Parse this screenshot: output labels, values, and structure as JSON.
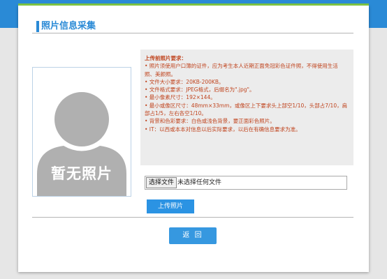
{
  "section": {
    "title": "照片信息采集"
  },
  "photo": {
    "placeholder_text": "暂无照片",
    "icon": "user-silhouette-icon"
  },
  "notes": {
    "title": "上传前照片要求：",
    "lines": [
      "• 照片须使用户口簿的证件，应为考生本人近期正面免冠彩色证件照，不得使用生活照、美颜照。",
      "• 文件大小要求：20KB-200KB。",
      "• 文件格式要求：JPEG格式，后缀名为\".jpg\"。",
      "• 最小像素尺寸：192×144。",
      "• 最小或像区尺寸：48mm×33mm，或像区上下要求头上部空1/10，头部占7/10，肩部占1/5，左右各空1/10。",
      "• 背景和色彩要求：白色或浅色背景，要正面彩色照片。",
      "• IT：以西或本本对信息以后实际要求，以后在有确信息要求为准。"
    ],
    "color": "#c0441e"
  },
  "file_input": {
    "button_label": "选择文件",
    "status": "未选择任何文件"
  },
  "buttons": {
    "upload": "上传照片",
    "return": "返  回"
  },
  "colors": {
    "accent": "#2a8ad6",
    "top_line": "#7cc242",
    "button": "#2b93e3"
  }
}
